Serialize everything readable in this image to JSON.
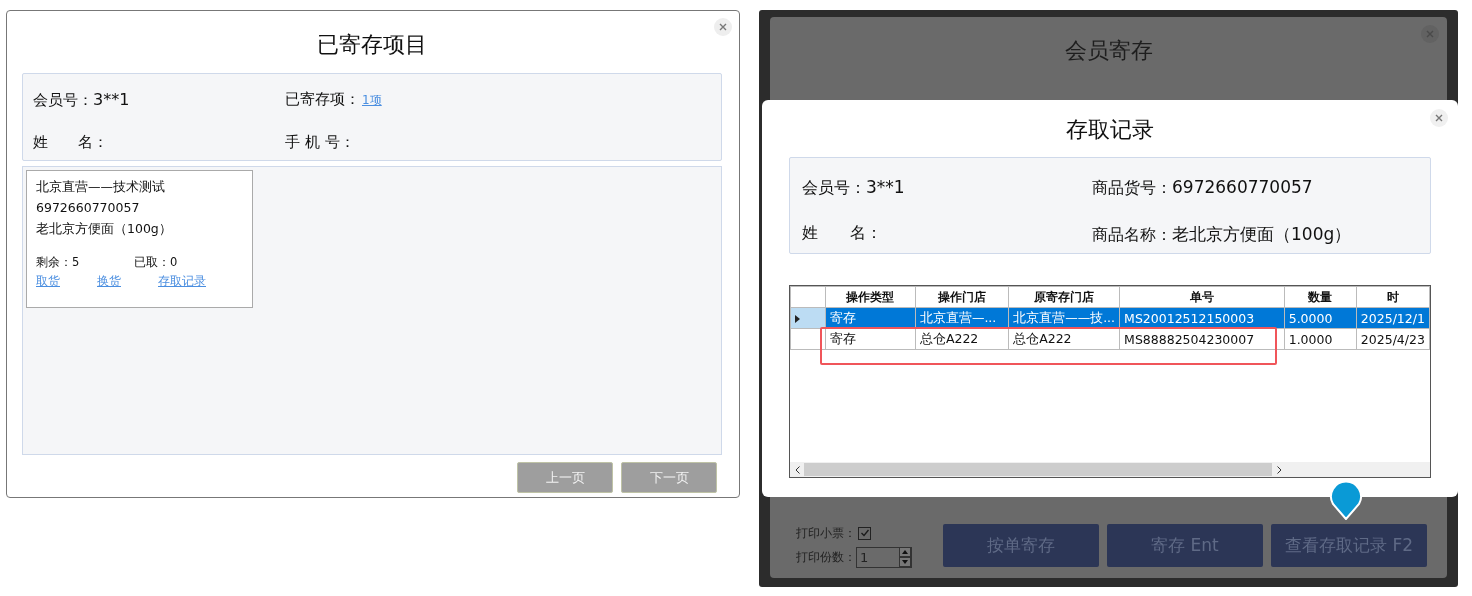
{
  "stored_items_dialog": {
    "title": "已寄存项目",
    "fields": [
      {
        "label": "会员号：",
        "value": "3**1"
      },
      {
        "label": "已寄存项：",
        "link": "1项"
      },
      {
        "label": "姓　　名："
      },
      {
        "label": "手 机 号："
      }
    ],
    "cards": [
      {
        "store": "北京直营——技术测试",
        "code": "6972660770057",
        "name": "老北京方便面（100g）",
        "stats": [
          {
            "label": "剩余：",
            "value": "5"
          },
          {
            "label": "已取：",
            "value": "0"
          }
        ],
        "actions": [
          "取货",
          "换货",
          "存取记录"
        ]
      }
    ],
    "pager": [
      {
        "label": "上一页",
        "disabled": true
      },
      {
        "label": "下一页",
        "disabled": true
      }
    ]
  },
  "member_deposit_window": {
    "title": "会员寄存",
    "print_receipt": {
      "label": "打印小票：",
      "checked": true
    },
    "copies": {
      "label": "打印份数：",
      "value": "1"
    },
    "buttons": [
      {
        "label": "按单寄存",
        "marked": false
      },
      {
        "label": "寄存 Ent",
        "marked": false
      },
      {
        "label": "查看存取记录 F2",
        "marked": true
      }
    ]
  },
  "records_dialog": {
    "title": "存取记录",
    "fields": [
      {
        "label": "会员号：",
        "value": "3**1"
      },
      {
        "label": "商品货号：",
        "value": "6972660770057"
      },
      {
        "label": "姓　　名："
      },
      {
        "label": "商品名称：",
        "value": "老北京方便面（100g）"
      }
    ],
    "table": {
      "columns": [
        "操作类型",
        "操作门店",
        "原寄存门店",
        "单号",
        "数量",
        "时"
      ],
      "rows": [
        {
          "cells": [
            "寄存",
            "北京直营—...",
            "北京直营——技...",
            "MS20012512150003",
            "5.0000",
            "2025/12/1"
          ],
          "selected": true,
          "highlighted": false
        },
        {
          "cells": [
            "寄存",
            "总仓A222",
            "总仓A222",
            "MS88882504230007",
            "1.0000",
            "2025/4/23"
          ],
          "selected": false,
          "highlighted": true
        }
      ]
    }
  }
}
